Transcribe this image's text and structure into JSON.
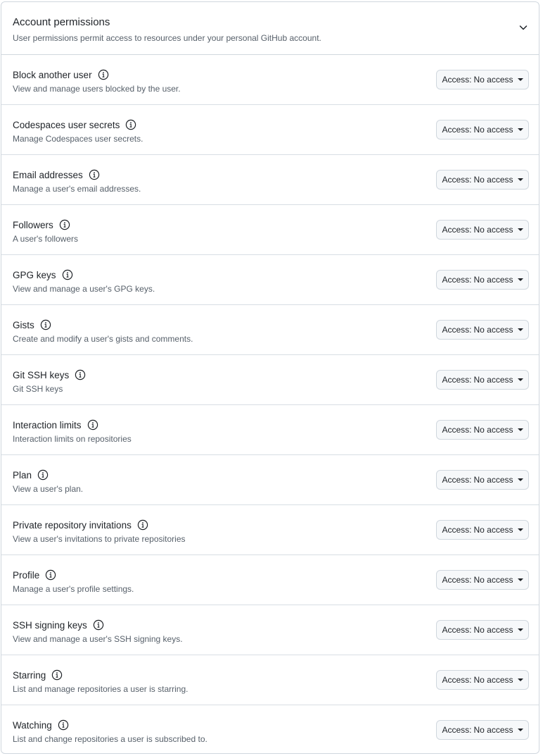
{
  "section": {
    "title": "Account permissions",
    "description": "User permissions permit access to resources under your personal GitHub account.",
    "collapse_icon": "chevron-down-icon"
  },
  "access_button": {
    "prefix": "Access:"
  },
  "permissions": [
    {
      "name": "Block another user",
      "description": "View and manage users blocked by the user.",
      "access": "No access"
    },
    {
      "name": "Codespaces user secrets",
      "description": "Manage Codespaces user secrets.",
      "access": "No access"
    },
    {
      "name": "Email addresses",
      "description": "Manage a user's email addresses.",
      "access": "No access"
    },
    {
      "name": "Followers",
      "description": "A user's followers",
      "access": "No access"
    },
    {
      "name": "GPG keys",
      "description": "View and manage a user's GPG keys.",
      "access": "No access"
    },
    {
      "name": "Gists",
      "description": "Create and modify a user's gists and comments.",
      "access": "No access"
    },
    {
      "name": "Git SSH keys",
      "description": "Git SSH keys",
      "access": "No access"
    },
    {
      "name": "Interaction limits",
      "description": "Interaction limits on repositories",
      "access": "No access"
    },
    {
      "name": "Plan",
      "description": "View a user's plan.",
      "access": "No access"
    },
    {
      "name": "Private repository invitations",
      "description": "View a user's invitations to private repositories",
      "access": "No access"
    },
    {
      "name": "Profile",
      "description": "Manage a user's profile settings.",
      "access": "No access"
    },
    {
      "name": "SSH signing keys",
      "description": "View and manage a user's SSH signing keys.",
      "access": "No access"
    },
    {
      "name": "Starring",
      "description": "List and manage repositories a user is starring.",
      "access": "No access"
    },
    {
      "name": "Watching",
      "description": "List and change repositories a user is subscribed to.",
      "access": "No access"
    }
  ],
  "colors": {
    "border": "#d0d7de",
    "text": "#1f2328",
    "muted": "#57606a",
    "button_bg": "#f6f8fa"
  }
}
